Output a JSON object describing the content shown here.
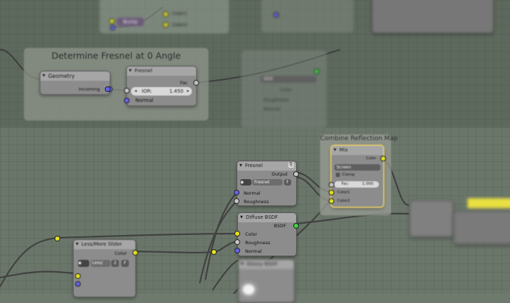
{
  "frames": {
    "fresnel_zero": "Determine Fresnel at 0 Angle",
    "combine_reflection": "Combine Reflection Map"
  },
  "top_nodes": {
    "bump_label": "Bump",
    "color1": "Color1",
    "color2": "Color2",
    "geometry": {
      "title": "Geometry",
      "incoming": "Incoming"
    },
    "fresnel": {
      "title": "Fresnel",
      "fac": "Fac",
      "ior_label": "IOR:",
      "ior_value": "1.450",
      "normal": "Normal"
    },
    "ggx": "GGX",
    "color": "Color",
    "roughness": "Roughness",
    "normal": "Normal"
  },
  "nodes": {
    "fresnel_group": {
      "title": "Fresnel",
      "output": "Output",
      "group": "Fresnel",
      "fake": "F",
      "normal": "Normal",
      "roughness": "Roughness"
    },
    "diffuse": {
      "title": "Diffuse BSDF",
      "bsdf": "BSDF",
      "color": "Color",
      "roughness": "Roughness",
      "normal": "Normal"
    },
    "mix": {
      "title": "Mix",
      "color_out": "Color",
      "blend": "Screen",
      "clamp": "Clamp",
      "fac_label": "Fac:",
      "fac_value": "1.000",
      "color1": "Color1",
      "color2": "Color2"
    },
    "slider": {
      "title": "Less/More Slider",
      "color": "Color",
      "group": "Less/",
      "users": "2",
      "fake": "F"
    },
    "glossy": {
      "title": "Glossy BSDF"
    }
  },
  "colors": {
    "socket_color": "#e3e31e",
    "socket_vector": "#6363e8",
    "socket_shader": "#42d44a",
    "socket_float": "#c6c6c6",
    "selected_outline": "#f1d067"
  }
}
